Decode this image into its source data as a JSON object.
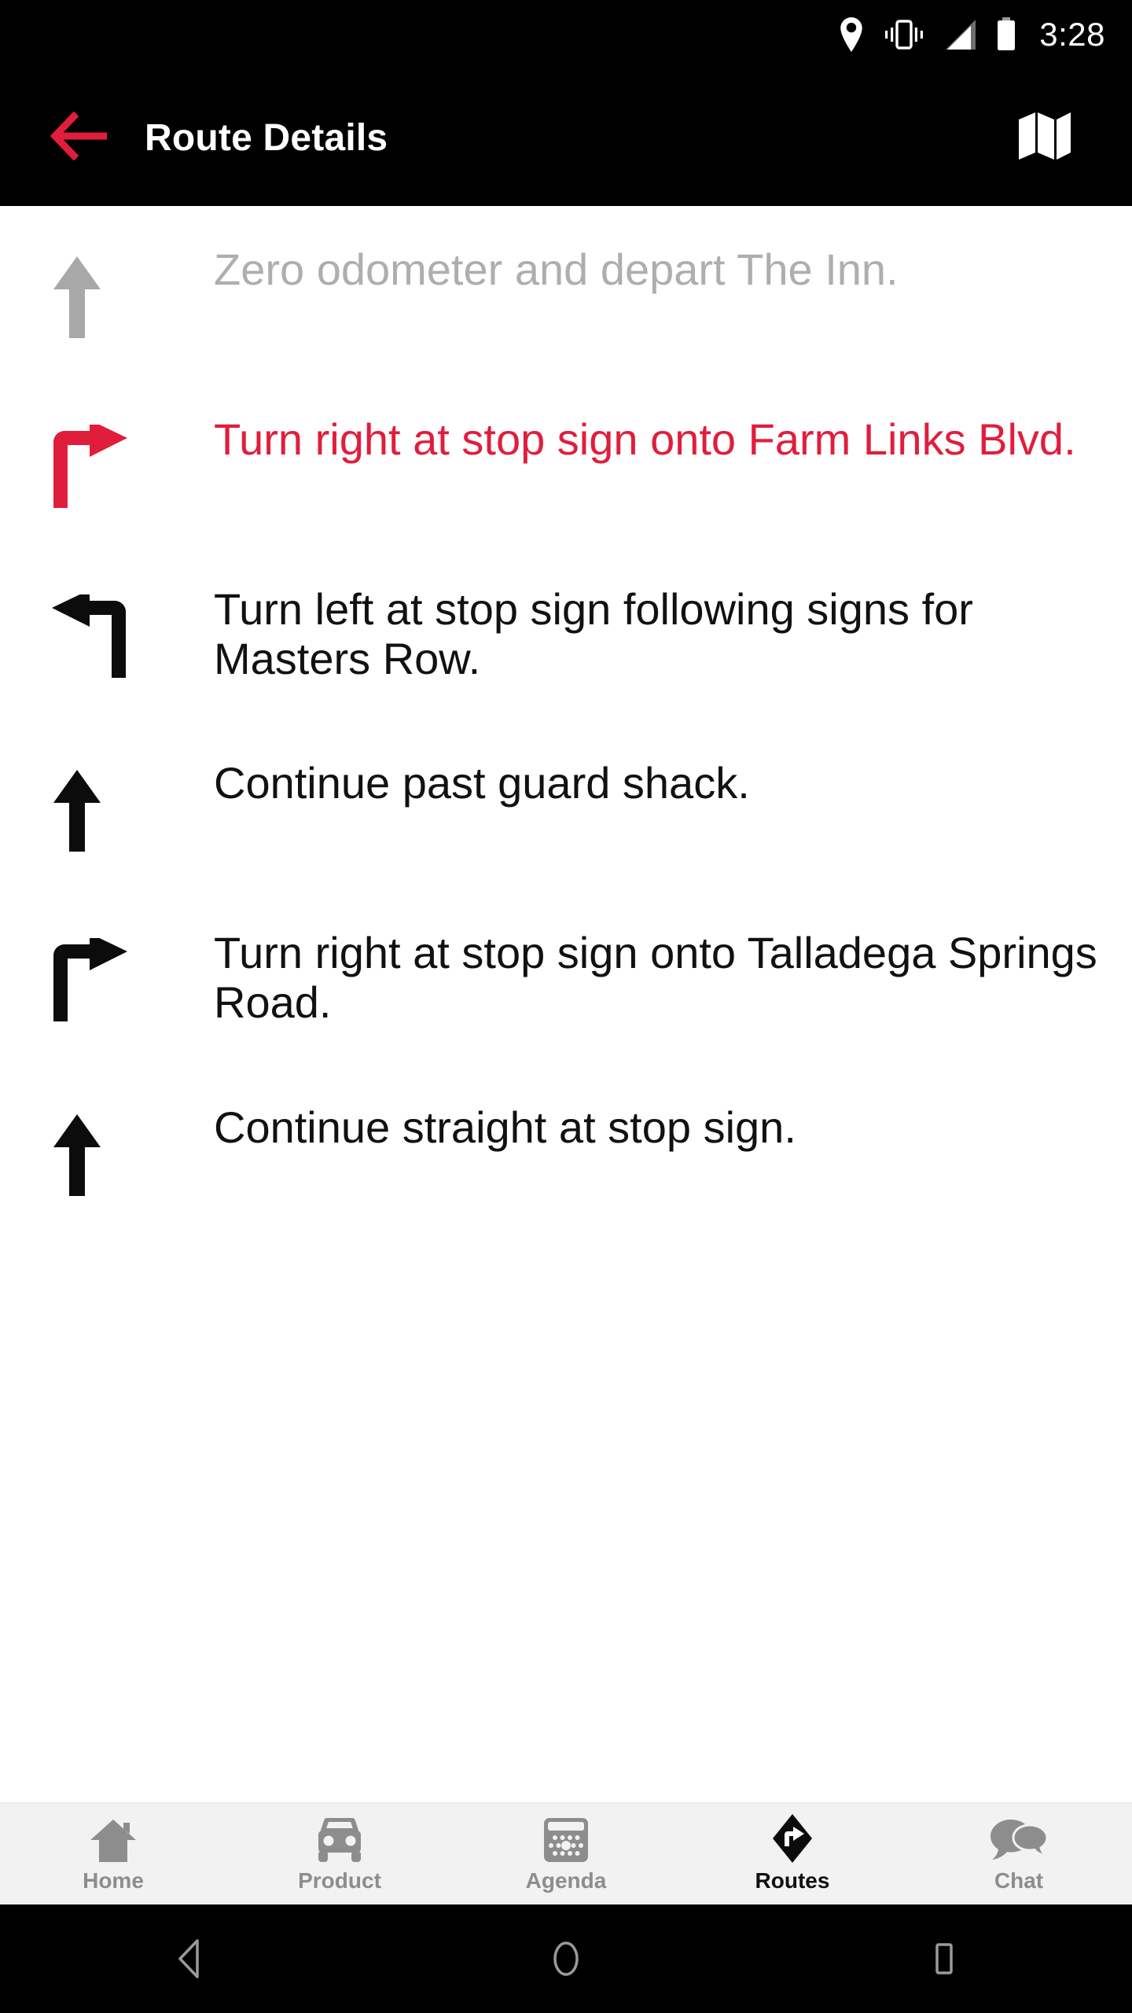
{
  "statusbar": {
    "time": "3:28",
    "icons": [
      "location-pin-icon",
      "vibrate-icon",
      "signal-icon",
      "battery-icon"
    ]
  },
  "appbar": {
    "back_icon": "back-arrow-icon",
    "title": "Route Details",
    "map_icon": "map-icon",
    "background": "#000000",
    "accent": "#e01e3c"
  },
  "route_steps": [
    {
      "icon": "arrow-straight-icon",
      "text": "Zero odometer and depart The Inn.",
      "state": "past",
      "color": "#aeaeae"
    },
    {
      "icon": "turn-right-icon",
      "text": "Turn right at stop sign onto Farm Links Blvd.",
      "state": "active",
      "color": "#e01e3c"
    },
    {
      "icon": "turn-left-icon",
      "text": "Turn left at stop sign following signs for Masters Row.",
      "state": "upcoming",
      "color": "#111111"
    },
    {
      "icon": "arrow-straight-icon",
      "text": "Continue past guard shack.",
      "state": "upcoming",
      "color": "#111111"
    },
    {
      "icon": "turn-right-icon",
      "text": "Turn right at stop sign onto Talladega Springs Road.",
      "state": "upcoming",
      "color": "#111111"
    },
    {
      "icon": "arrow-straight-icon",
      "text": "Continue straight at stop sign.",
      "state": "upcoming",
      "color": "#111111"
    }
  ],
  "bottom_nav": {
    "active_index": 3,
    "items": [
      {
        "label": "Home",
        "icon": "home-icon"
      },
      {
        "label": "Product",
        "icon": "car-icon"
      },
      {
        "label": "Agenda",
        "icon": "calendar-icon"
      },
      {
        "label": "Routes",
        "icon": "routes-diamond-icon"
      },
      {
        "label": "Chat",
        "icon": "chat-bubbles-icon"
      }
    ],
    "inactive_color": "#8d8d8d",
    "active_color": "#101010",
    "background": "#f2f2f3"
  },
  "android_nav": {
    "buttons": [
      {
        "name": "back-triangle-icon"
      },
      {
        "name": "home-circle-icon"
      },
      {
        "name": "recents-square-icon"
      }
    ]
  }
}
